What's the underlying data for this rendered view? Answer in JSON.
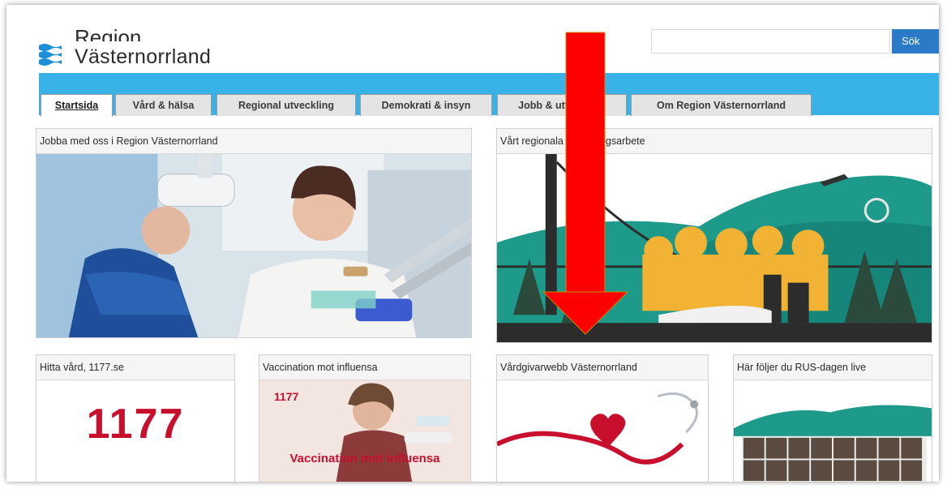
{
  "header": {
    "logo_line1": "Region",
    "logo_line2": "Västernorrland",
    "search_placeholder": "",
    "search_button": "Sök"
  },
  "nav": {
    "tabs": [
      {
        "label": "Startsida",
        "active": true
      },
      {
        "label": "Vård & hälsa"
      },
      {
        "label": "Regional utveckling"
      },
      {
        "label": "Demokrati & insyn"
      },
      {
        "label": "Jobb & utveckling"
      },
      {
        "label": "Om Region Västernorrland"
      }
    ]
  },
  "cards": {
    "jobba": {
      "title": "Jobba med oss i Region Västernorrland"
    },
    "regional": {
      "title": "Vårt regionala utvecklingsarbete"
    },
    "hitta": {
      "title": "Hitta vård, 1177.se",
      "logo": "1177"
    },
    "vaccination": {
      "title": "Vaccination mot influensa",
      "badge": "1177",
      "caption": "Vaccination mot influensa"
    },
    "vardgivar": {
      "title": "Vårdgivarwebb Västernorrland"
    },
    "rus": {
      "title": "Här följer du RUS-dagen live"
    }
  },
  "colors": {
    "navbar": "#39b2e8",
    "arrow": "#ff0000",
    "brand_1177": "#c8102e",
    "logo_blue": "#1d8fd6"
  },
  "icons": {
    "logo": "region-wave-logo",
    "overlay": "red-down-arrow"
  }
}
